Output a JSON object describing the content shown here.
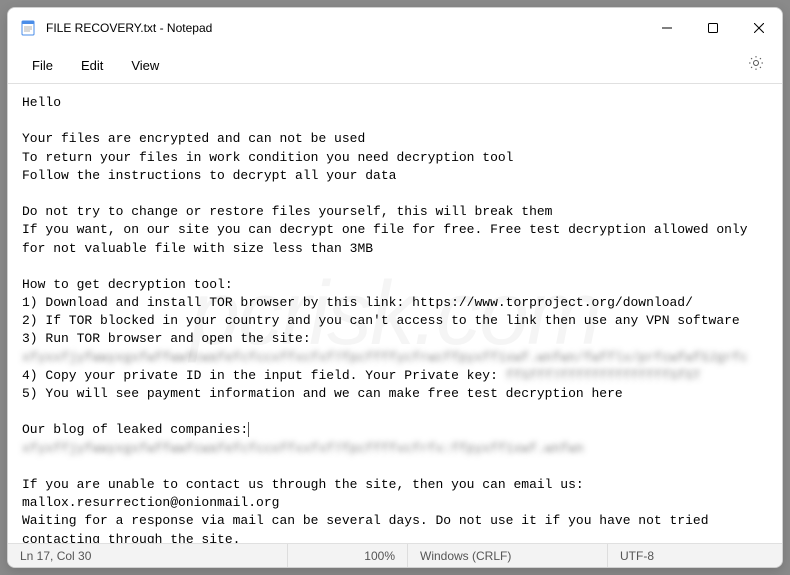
{
  "titlebar": {
    "title": "FILE RECOVERY.txt - Notepad"
  },
  "menubar": {
    "file": "File",
    "edit": "Edit",
    "view": "View"
  },
  "body": {
    "line1": "Hello",
    "line2": "",
    "line3": "Your files are encrypted and can not be used",
    "line4": "To return your files in work condition you need decryption tool",
    "line5": "Follow the instructions to decrypt all your data",
    "line6": "",
    "line7": "Do not try to change or restore files yourself, this will break them",
    "line8": "If you want, on our site you can decrypt one file for free. Free test decryption allowed only for not valuable file with size less than 3MB",
    "line9": "",
    "line10": "How to get decryption tool:",
    "line11": "1) Download and install TOR browser by this link: https://www.torproject.org/download/",
    "line12": "2) If TOR blocked in your country and you can't access to the link then use any VPN software",
    "line13": "3) Run TOR browser and open the site:",
    "line14_blur": "xfyxxfjyfwwyxgxfwffwwfcwafefcfccxffxcfxf7fpcffffycfrwcffpyxff1xwf.wnfwn/fwfflx/prfcwfwfSJgrfc",
    "line15a": "4) Copy your private ID in the input field. Your Private key: ",
    "line15b_blur": "ffSfff7ffffffffffffffSfST",
    "line16": "5) You will see payment information and we can make free test decryption here",
    "line17": "",
    "line18a": "Our blog of leaked companies:",
    "line18b": "",
    "line19_blur": "xfyxffjyfwwyxgxfwffwwfcwafefcfccoffxxfxf7fpcffffvcfrfx:ffpyxff1xwf.wnfwn",
    "line20": "",
    "line21": "If you are unable to contact us through the site, then you can email us: mallox.resurrection@onionmail.org",
    "line22": "Waiting for a response via mail can be several days. Do not use it if you have not tried contacting through the site."
  },
  "statusbar": {
    "position": "Ln 17, Col 30",
    "zoom": "100%",
    "line_ending": "Windows (CRLF)",
    "encoding": "UTF-8"
  },
  "watermark": "pcrisk.com"
}
